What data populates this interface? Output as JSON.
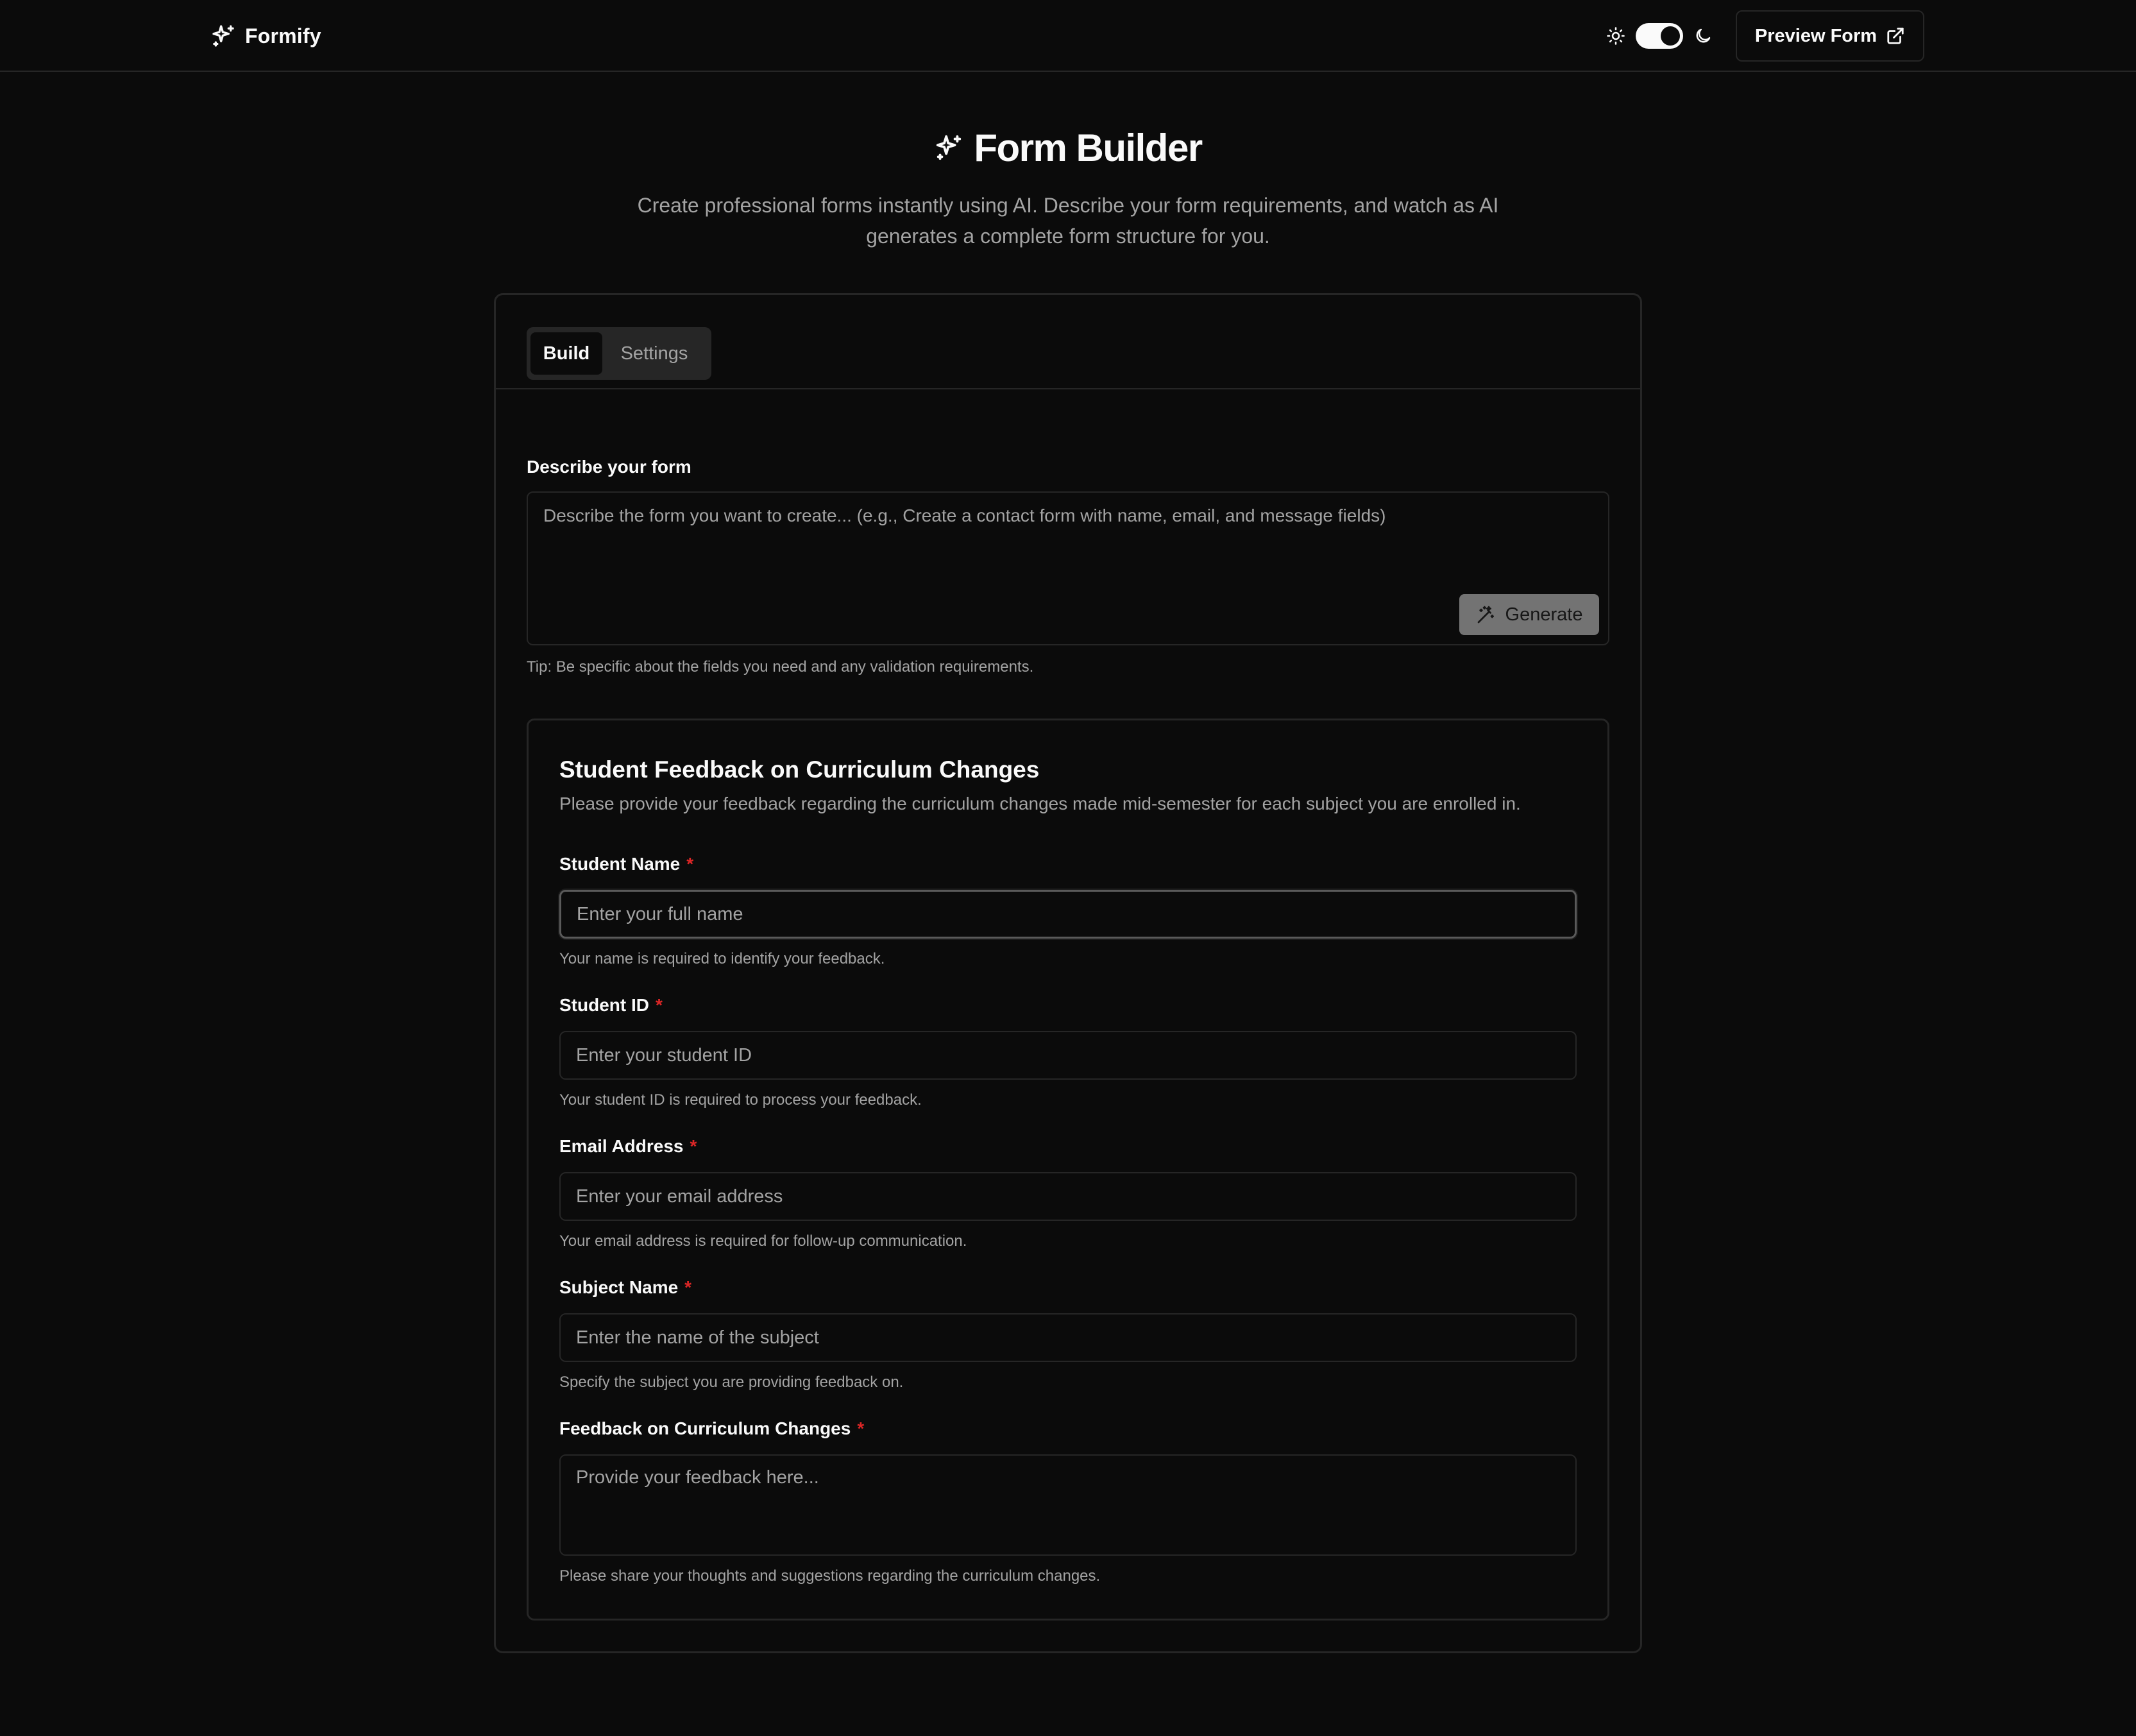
{
  "header": {
    "brand": "Formify",
    "preview_label": "Preview Form",
    "theme": {
      "mode": "dark"
    }
  },
  "hero": {
    "title": "Form Builder",
    "description": "Create professional forms instantly using AI. Describe your form requirements, and watch as AI generates a complete form structure for you."
  },
  "tabs": [
    {
      "label": "Build",
      "active": true
    },
    {
      "label": "Settings",
      "active": false
    }
  ],
  "builder": {
    "describe_label": "Describe your form",
    "prompt_value": "",
    "prompt_placeholder": "Describe the form you want to create... (e.g., Create a contact form with name, email, and message fields)",
    "generate_label": "Generate",
    "tip": "Tip: Be specific about the fields you need and any validation requirements."
  },
  "form": {
    "title": "Student Feedback on Curriculum Changes",
    "description": "Please provide your feedback regarding the curriculum changes made mid-semester for each subject you are enrolled in.",
    "fields": [
      {
        "label": "Student Name",
        "required": "*",
        "placeholder": "Enter your full name",
        "help": "Your name is required to identify your feedback."
      },
      {
        "label": "Student ID",
        "required": "*",
        "placeholder": "Enter your student ID",
        "help": "Your student ID is required to process your feedback."
      },
      {
        "label": "Email Address",
        "required": "*",
        "placeholder": "Enter your email address",
        "help": "Your email address is required for follow-up communication."
      },
      {
        "label": "Subject Name",
        "required": "*",
        "placeholder": "Enter the name of the subject",
        "help": "Specify the subject you are providing feedback on."
      },
      {
        "label": "Feedback on Curriculum Changes",
        "required": "*",
        "placeholder": "Provide your feedback here...",
        "help": "Please share your thoughts and suggestions regarding the curriculum changes."
      }
    ]
  },
  "colors": {
    "background": "#0b0b0b",
    "border": "#262626",
    "muted_text": "#a3a3a3",
    "required_asterisk": "#dc2626"
  }
}
